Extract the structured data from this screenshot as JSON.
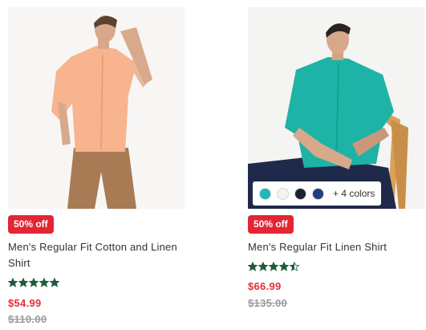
{
  "products": [
    {
      "badge": "50% off",
      "title": "Men's Regular Fit Cotton and Linen Shirt",
      "rating": 5,
      "price": "$54.99",
      "old_price": "$110.00",
      "shirt_color": "#f7b48f"
    },
    {
      "badge": "50% off",
      "title": "Men's Regular Fit Linen Shirt",
      "rating": 4.5,
      "price": "$66.99",
      "old_price": "$135.00",
      "shirt_color": "#1db3a6",
      "swatches": [
        "#1fb7b8",
        "#f4f4f4",
        "#1c2133",
        "#1f3f7e"
      ],
      "more_colors": "+ 4 colors"
    }
  ],
  "colors": {
    "badge_bg": "#e32633",
    "price": "#e0303a",
    "star": "#1f5c3a"
  }
}
